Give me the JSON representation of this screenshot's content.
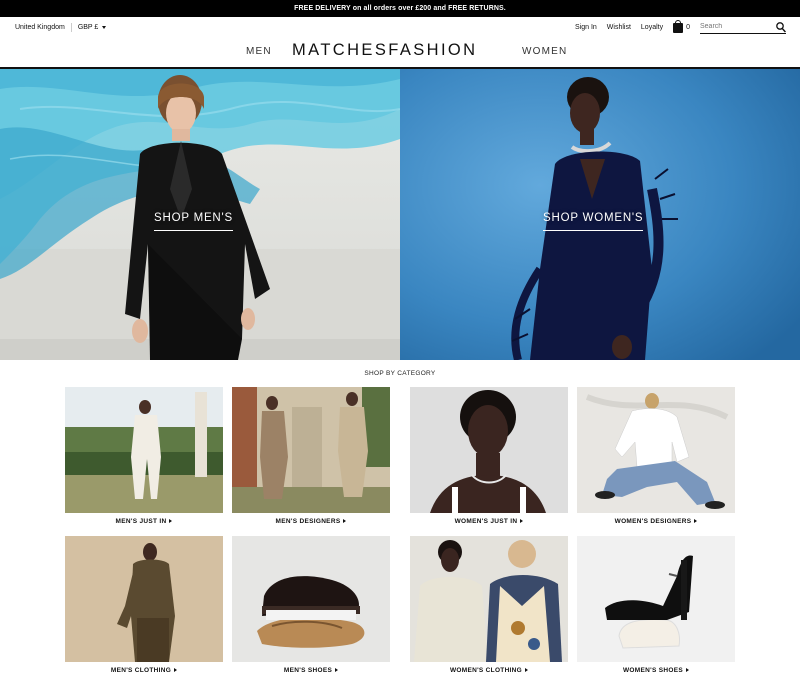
{
  "promo": "FREE DELIVERY on all orders over £200 and FREE RETURNS.",
  "util": {
    "country": "United Kingdom",
    "currency": "GBP £",
    "sign_in": "Sign In",
    "wishlist": "Wishlist",
    "loyalty": "Loyalty",
    "bag_count": "0",
    "search_placeholder": "Search"
  },
  "nav": {
    "men": "MEN",
    "logo": "MATCHESFASHION",
    "women": "WOMEN"
  },
  "hero": {
    "men_cta": "SHOP MEN'S",
    "women_cta": "SHOP WOMEN'S"
  },
  "categories": {
    "heading": "SHOP BY CATEGORY",
    "items": [
      {
        "label": "MEN'S JUST IN"
      },
      {
        "label": "MEN'S DESIGNERS"
      },
      {
        "label": "WOMEN'S JUST IN"
      },
      {
        "label": "WOMEN'S DESIGNERS"
      },
      {
        "label": "MEN'S CLOTHING"
      },
      {
        "label": "MEN'S SHOES"
      },
      {
        "label": "WOMEN'S CLOTHING"
      },
      {
        "label": "WOMEN'S SHOES"
      }
    ]
  },
  "colors": {
    "promo_bg": "#000000",
    "hero_women_bg": "#3b86c2",
    "hero_men_fabric": "#4fb8d8"
  },
  "icons": [
    "search-icon",
    "bag-icon",
    "chevron-down-icon",
    "arrow-right-icon"
  ]
}
